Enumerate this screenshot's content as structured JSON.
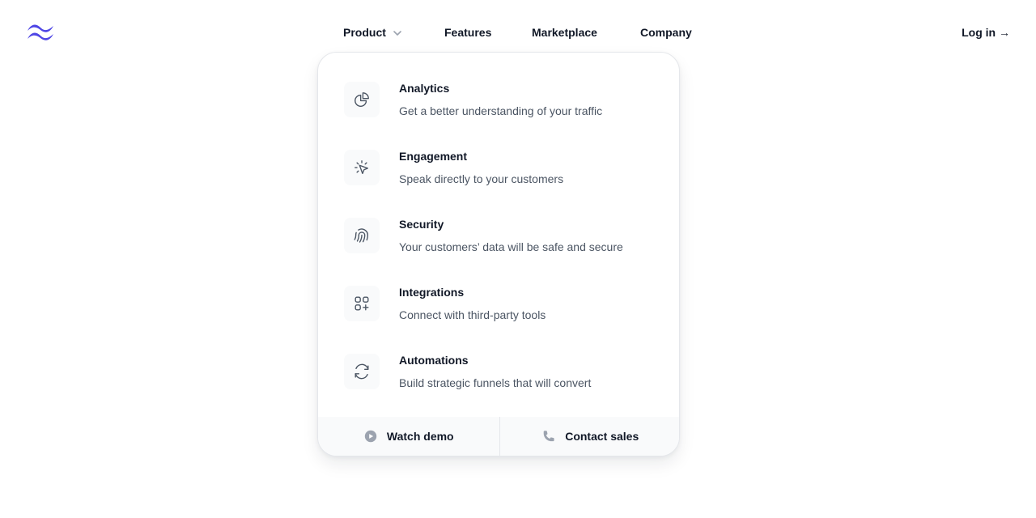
{
  "brand": {
    "logo_icon": "tailwind-wave-icon",
    "color": "#4f46e5"
  },
  "nav": {
    "items": [
      {
        "label": "Product",
        "has_dropdown": true
      },
      {
        "label": "Features"
      },
      {
        "label": "Marketplace"
      },
      {
        "label": "Company"
      }
    ]
  },
  "login": {
    "label": "Log in →"
  },
  "flyout": {
    "items": [
      {
        "title": "Analytics",
        "description": "Get a better understanding of your traffic",
        "icon": "chart-pie-icon"
      },
      {
        "title": "Engagement",
        "description": "Speak directly to your customers",
        "icon": "cursor-click-icon"
      },
      {
        "title": "Security",
        "description": "Your customers’ data will be safe and secure",
        "icon": "fingerprint-icon"
      },
      {
        "title": "Integrations",
        "description": "Connect with third-party tools",
        "icon": "squares-plus-icon"
      },
      {
        "title": "Automations",
        "description": "Build strategic funnels that will convert",
        "icon": "arrow-path-icon"
      }
    ],
    "footer": [
      {
        "label": "Watch demo",
        "icon": "play-circle-icon"
      },
      {
        "label": "Contact sales",
        "icon": "phone-icon"
      }
    ]
  }
}
